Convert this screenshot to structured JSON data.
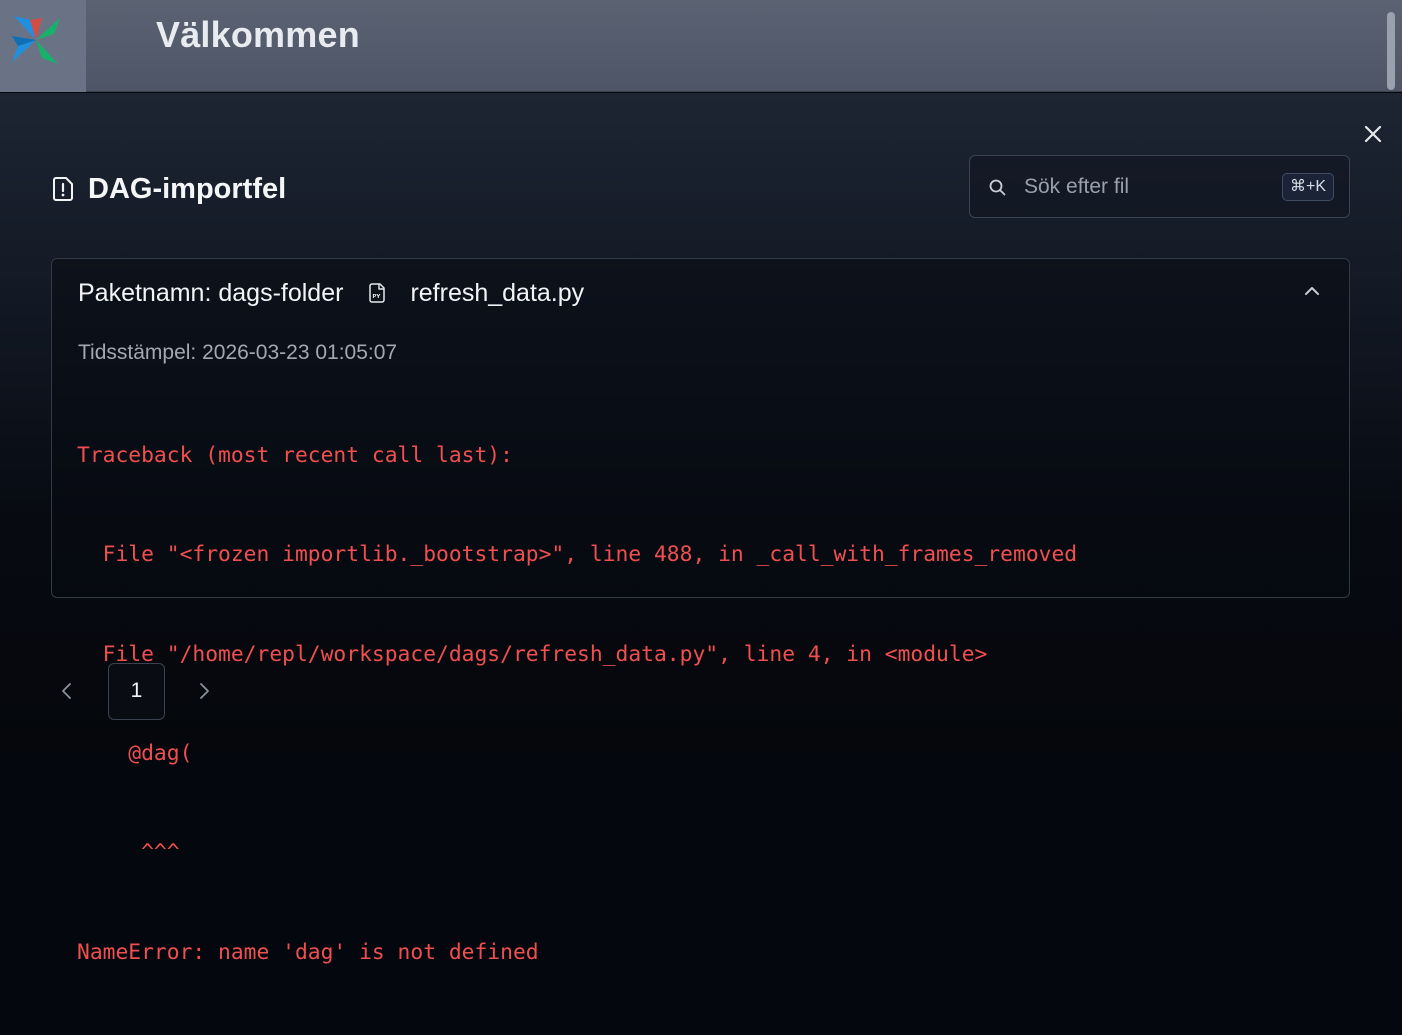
{
  "topbar": {
    "title": "Välkommen",
    "logo_icon": "pinwheel-logo-icon"
  },
  "modal": {
    "title": "DAG-importfel",
    "title_icon": "file-alert-icon",
    "close_icon": "close-icon",
    "search": {
      "placeholder": "Sök efter fil",
      "value": "",
      "shortcut": "⌘+K",
      "icon": "search-icon"
    },
    "errors": [
      {
        "bundle_label": "Paketnamn: dags-folder",
        "file_icon": "python-file-icon",
        "file_name": "refresh_data.py",
        "expanded": true,
        "timestamp_text": "Tidsstämpel: 2026-03-23 01:05:07",
        "trace_lines": [
          "Traceback (most recent call last):",
          "  File \"<frozen importlib._bootstrap>\", line 488, in _call_with_frames_removed",
          "  File \"/home/repl/workspace/dags/refresh_data.py\", line 4, in <module>",
          "    @dag(",
          "     ^^^",
          "NameError: name 'dag' is not defined"
        ]
      }
    ],
    "pagination": {
      "current_page": "1",
      "prev_icon": "chevron-left-icon",
      "next_icon": "chevron-right-icon"
    }
  },
  "colors": {
    "error_text": "#f04f4f",
    "topbar_bg": "#5b6373",
    "logo_blue": "#1f8fe0",
    "logo_green": "#17b26a",
    "logo_red": "#e5473c"
  }
}
